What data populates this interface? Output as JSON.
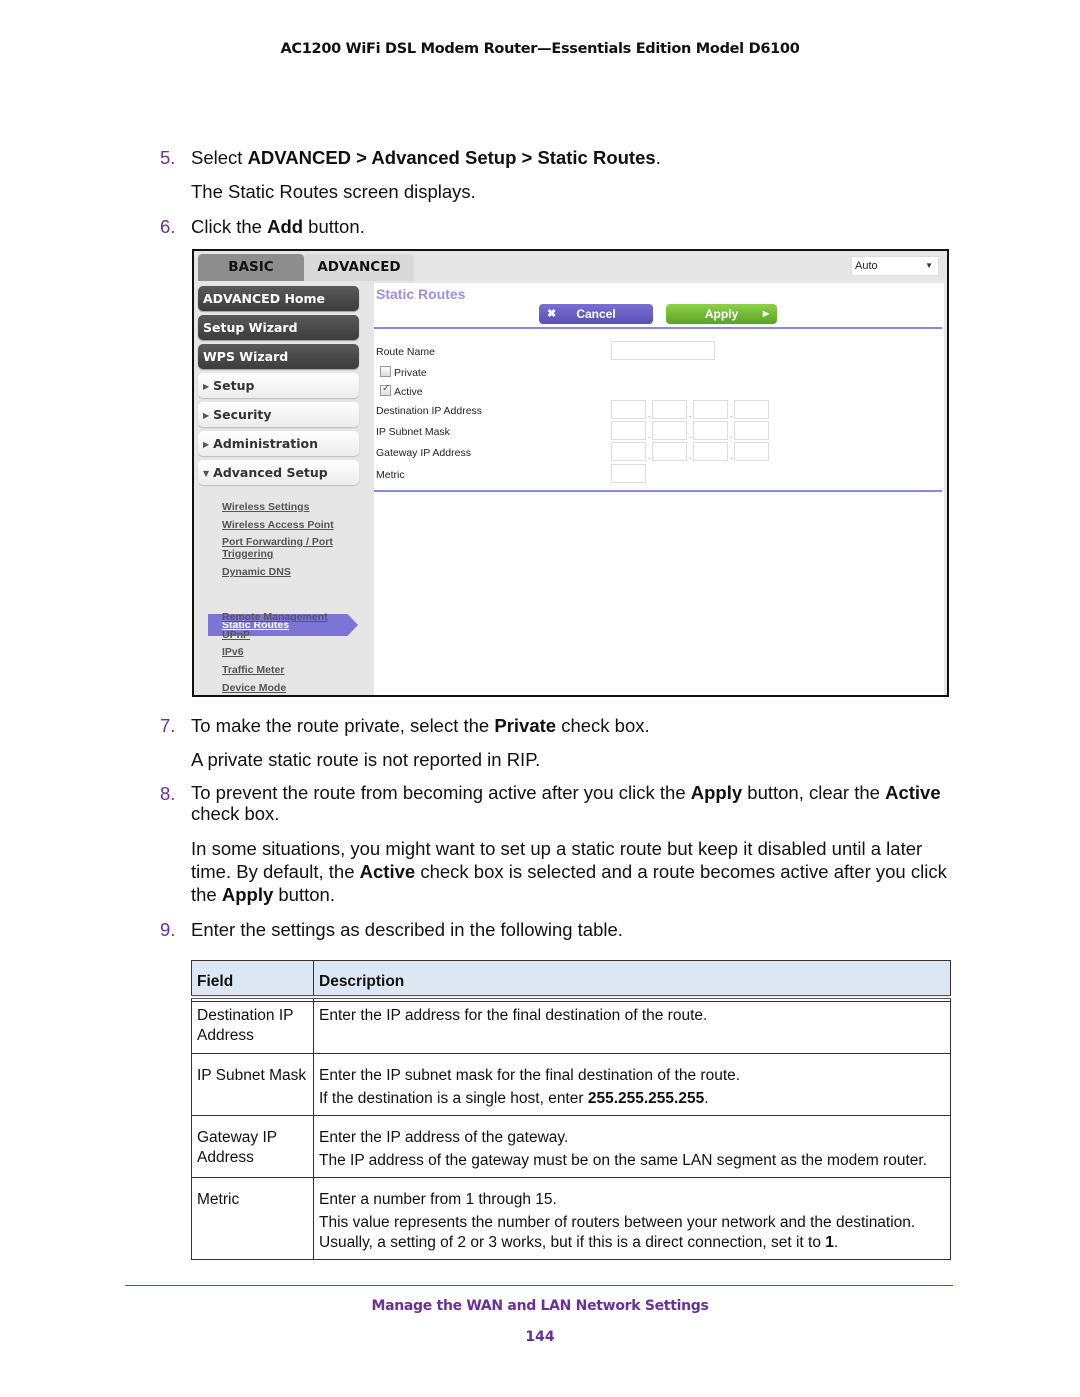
{
  "header": {
    "title": "AC1200 WiFi DSL Modem Router—Essentials Edition Model D6100"
  },
  "steps": {
    "s5": {
      "num": "5.",
      "pre": "Select ",
      "b1": "ADVANCED > Advanced Setup > Static Routes",
      "post": ".",
      "sub": "The Static Routes screen displays."
    },
    "s6": {
      "num": "6.",
      "pre": "Click the ",
      "b1": "Add",
      "post": " button."
    },
    "s7": {
      "num": "7.",
      "pre": "To make the route private, select the ",
      "b1": "Private",
      "post": " check box.",
      "sub": "A private static route is not reported in RIP."
    },
    "s8": {
      "num": "8.",
      "pre": "To prevent the route from becoming active after you click the ",
      "b1": "Apply",
      "mid": " button, clear the ",
      "b2": "Active",
      "post": " check box.",
      "sub_pre": "In some situations, you might want to set up a static route but keep it disabled until a later time. By default, the ",
      "sub_b1": "Active",
      "sub_mid": " check box is selected and a route becomes active after you click the ",
      "sub_b2": "Apply",
      "sub_post": " button."
    },
    "s9": {
      "num": "9.",
      "text": "Enter the settings as described in the following table."
    }
  },
  "router_ui": {
    "tabs": {
      "basic": "BASIC",
      "advanced": "ADVANCED"
    },
    "language_select": {
      "value": "Auto"
    },
    "sidebar": {
      "main_buttons": [
        "ADVANCED Home",
        "Setup Wizard",
        "WPS Wizard"
      ],
      "sections": [
        "Setup",
        "Security",
        "Administration",
        "Advanced Setup"
      ],
      "sub_links": [
        "Wireless Settings",
        "Wireless Access Point",
        "Port Forwarding / Port",
        "Triggering",
        "Dynamic DNS",
        "Static Routes",
        "Remote Management",
        "UPnP",
        "IPv6",
        "Traffic Meter",
        "Device Mode"
      ],
      "active_sub_link": "Static Routes"
    },
    "content": {
      "title": "Static Routes",
      "cancel_label": "Cancel",
      "apply_label": "Apply",
      "route_name_label": "Route Name",
      "route_name_value": "",
      "private_label": "Private",
      "private_checked": false,
      "active_label": "Active",
      "active_checked": true,
      "dest_ip_label": "Destination IP Address",
      "subnet_label": "IP Subnet Mask",
      "gateway_label": "Gateway IP Address",
      "metric_label": "Metric"
    },
    "colors": {
      "accent_purple": "#7e74d6",
      "apply_green": "#6db530",
      "title_purple": "#9c8fe6"
    }
  },
  "table": {
    "headers": [
      "Field",
      "Description"
    ],
    "rows": [
      {
        "field": "Destination IP Address",
        "desc": [
          "Enter the IP address for the final destination of the route."
        ]
      },
      {
        "field": "IP Subnet Mask",
        "desc": [
          "Enter the IP subnet mask for the final destination of the route.",
          "If the destination is a single host, enter "
        ],
        "bold_tail": "255.255.255.255",
        "tail_post": "."
      },
      {
        "field": "Gateway IP Address",
        "desc": [
          "Enter the IP address of the gateway.",
          "The IP address of the gateway must be on the same LAN segment as the modem router."
        ]
      },
      {
        "field": "Metric",
        "desc": [
          "Enter a number from 1 through 15.",
          "This value represents the number of routers between your network and the destination.",
          "Usually, a setting of 2 or 3 works, but if this is a direct connection, set it to "
        ],
        "bold_tail": "1",
        "tail_post": "."
      }
    ]
  },
  "footer": {
    "section": "Manage the WAN and LAN Network Settings",
    "page": "144"
  }
}
